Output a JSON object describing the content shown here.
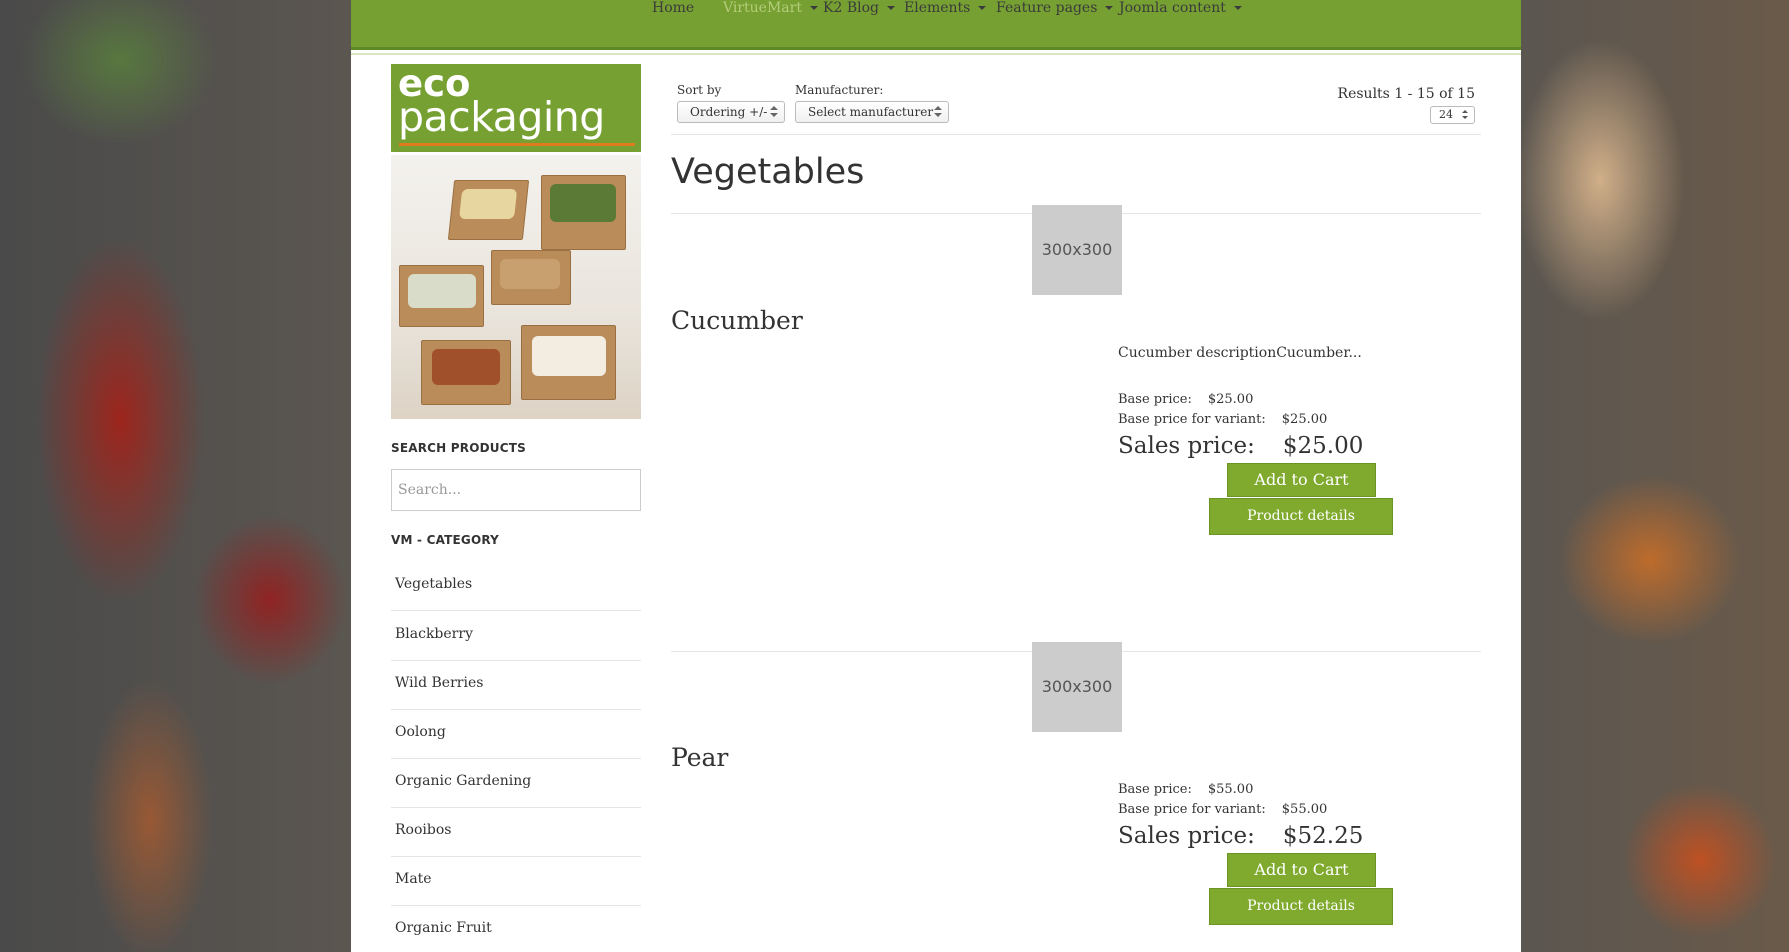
{
  "nav": {
    "items": [
      {
        "label": "Home",
        "has_caret": false
      },
      {
        "label": "VirtueMart",
        "has_caret": true
      },
      {
        "label": "K2 Blog",
        "has_caret": true
      },
      {
        "label": "Elements",
        "has_caret": true
      },
      {
        "label": "Feature pages",
        "has_caret": true
      },
      {
        "label": "Joomla content",
        "has_caret": true
      }
    ],
    "active": "VirtueMart"
  },
  "sidebar": {
    "banner": {
      "line1": "eco",
      "line2": "packaging"
    },
    "search": {
      "heading": "SEARCH PRODUCTS",
      "placeholder": "Search..."
    },
    "category": {
      "heading": "VM - CATEGORY",
      "items": [
        "Vegetables",
        "Blackberry",
        "Wild Berries",
        "Oolong",
        "Organic Gardening",
        "Rooibos",
        "Mate",
        "Organic Fruit"
      ]
    }
  },
  "toolbar": {
    "sort_label": "Sort by",
    "sort_value": "Ordering +/-",
    "manufacturer_label": "Manufacturer:",
    "manufacturer_value": "Select manufacturer",
    "results": "Results 1 - 15 of 15",
    "per_page": "24"
  },
  "category_title": "Vegetables",
  "products": [
    {
      "name": "Cucumber",
      "thumb": "300x300",
      "description": "Cucumber descriptionCucumber...",
      "base_price_label": "Base price:",
      "base_price": "$25.00",
      "variant_label": "Base price for variant:",
      "variant_price": "$25.00",
      "sales_label": "Sales price:",
      "sales_price": "$25.00",
      "cart_label": "Add to Cart",
      "details_label": "Product details"
    },
    {
      "name": "Pear",
      "thumb": "300x300",
      "description": "",
      "base_price_label": "Base price:",
      "base_price": "$55.00",
      "variant_label": "Base price for variant:",
      "variant_price": "$55.00",
      "sales_label": "Sales price:",
      "sales_price": "$52.25",
      "cart_label": "Add to Cart",
      "details_label": "Product details"
    }
  ],
  "colors": {
    "accent": "#76a032",
    "button": "#7faa2e",
    "active_nav": "#b5cc7a"
  }
}
